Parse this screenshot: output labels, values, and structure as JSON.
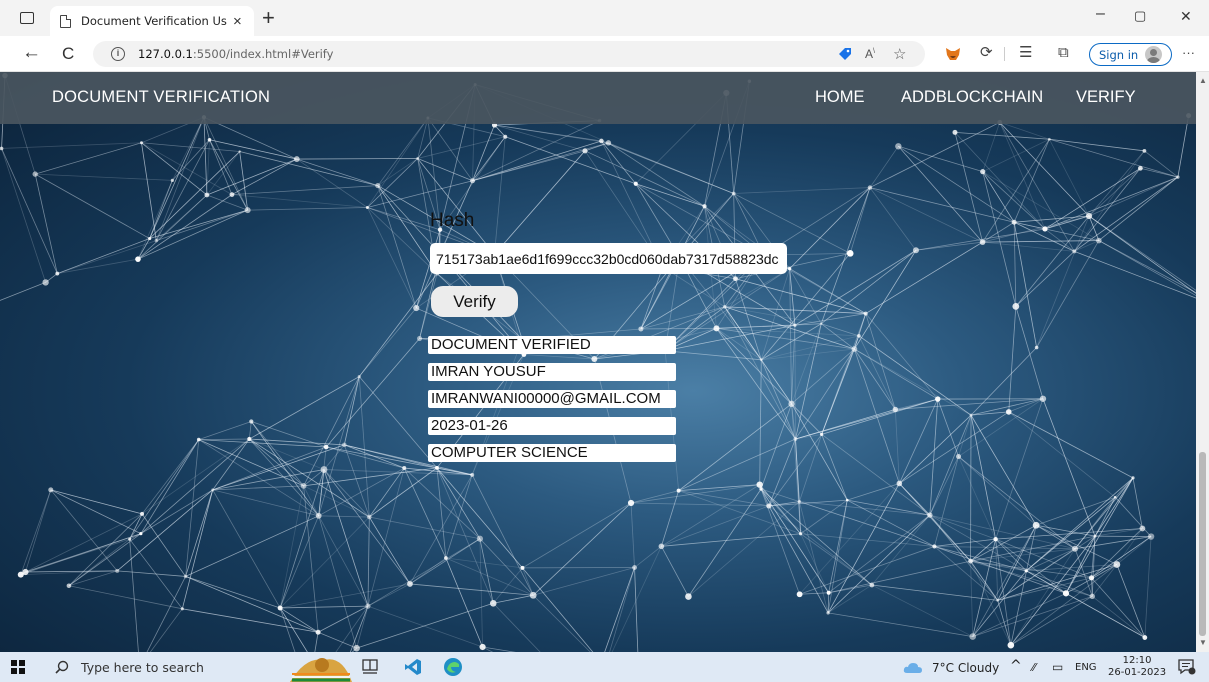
{
  "browser": {
    "tab_title": "Document Verification Using Blo",
    "tab_close": "×",
    "new_tab": "+",
    "url_host": "127.0.0.1",
    "url_rest": ":5500/index.html#Verify",
    "sign_in": "Sign in",
    "more": "···",
    "back": "←",
    "refresh": "C",
    "minimize": "–",
    "restore": "▢",
    "close": "✕"
  },
  "site": {
    "brand": "DOCUMENT VERIFICATION",
    "nav": [
      "HOME",
      "ADDBLOCKCHAIN",
      "VERIFY"
    ]
  },
  "verify": {
    "hash_label": "Hash",
    "hash_value": "715173ab1ae6d1f699ccc32b0cd060dab7317d58823dc",
    "button": "Verify",
    "results": [
      "DOCUMENT VERIFIED",
      "IMRAN YOUSUF",
      "IMRANWANI00000@GMAIL.COM",
      "2023-01-26",
      "COMPUTER SCIENCE"
    ]
  },
  "taskbar": {
    "search_placeholder": "Type here to search",
    "weather": "7°C  Cloudy",
    "language": "ENG",
    "time": "12:10",
    "date": "26-01-2023"
  },
  "colors": {
    "site_nav": "#4a5660",
    "signin_border": "#0b6ac5",
    "vscode_blue": "#2489ca",
    "edge_teal": "#1f8fc5"
  }
}
